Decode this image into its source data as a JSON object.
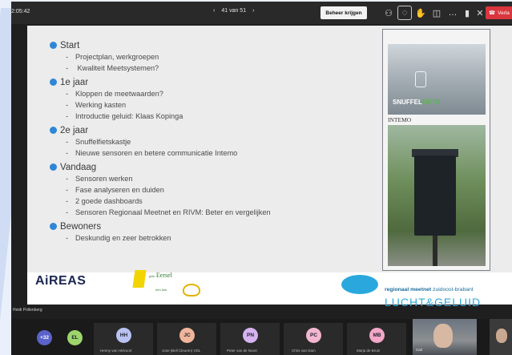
{
  "topbar": {
    "clock": "2:05:42",
    "page_counter": "41 van 51",
    "prev_icon": "chevron-left-icon",
    "next_icon": "chevron-right-icon",
    "take_control_label": "Beheer krijgen",
    "leave_label": "Verla",
    "icons": [
      "people-icon",
      "chat-icon",
      "reactions-icon",
      "share-icon",
      "more-icon",
      "camera-off-icon",
      "mic-off-icon",
      "share-screen-icon",
      "phone-hangup-icon"
    ]
  },
  "slide": {
    "sections": [
      {
        "heading": "Start",
        "items": [
          "Projectplan, werkgroepen",
          " Kwaliteit Meetsystemen?"
        ]
      },
      {
        "heading": "1e jaar",
        "items": [
          "Kloppen de meetwaarden?",
          "Werking kasten",
          "Introductie geluid: Klaas Kopinga"
        ]
      },
      {
        "heading": "2e jaar",
        "items": [
          "Snuffelfietskastje",
          "Nieuwe sensoren en betere communicatie Intemo"
        ]
      },
      {
        "heading": "Vandaag",
        "items": [
          "Sensoren werken",
          "Fase analyseren en duiden",
          "2 goede dashboards",
          "Sensoren Regionaal Meetnet en RIVM:  Beter en vergelijken"
        ]
      },
      {
        "heading": "Bewoners",
        "items": [
          "Deskundig en zeer betrokken"
        ]
      }
    ],
    "photo1_label_a": "SNUFFEL",
    "photo1_label_b": "FIETS",
    "photo2_caption": "INTEMO",
    "footer": {
      "areas_logo": "AiREAS",
      "eersel_name": "Eersel",
      "eersel_small": "gem",
      "eersel_tagline": "een tuin",
      "meetnet_line1_bold": "regionaal meetnet",
      "meetnet_line1_rest": " zuidoost-brabant",
      "meetnet_line2": "LUCHT&GELUID"
    }
  },
  "presenter_name": "Heidi Pollenberg",
  "participants": {
    "overflow_count": "+32",
    "people": [
      {
        "initials": "EL",
        "name": "",
        "color": "#9ed56b"
      },
      {
        "initials": "HH",
        "name": "Henny van Helvoort",
        "color": "#b9c2f2"
      },
      {
        "initials": "JC",
        "name": "Jose (Bell Cleuren) VDL",
        "color": "#f0b59b"
      },
      {
        "initials": "PN",
        "name": "Peter van de Noort",
        "color": "#d6b3f0"
      },
      {
        "initials": "PC",
        "name": "Chris van Dam",
        "color": "#f3b6d0"
      },
      {
        "initials": "MB",
        "name": "Marja de Bruin",
        "color": "#f4a7c8"
      }
    ],
    "video_name": "Carl"
  }
}
